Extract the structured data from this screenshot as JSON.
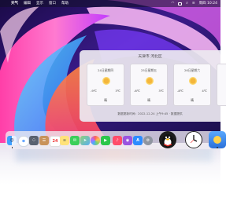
{
  "menubar": {
    "apple_glyph": "",
    "items": [
      "天气",
      "编辑",
      "显示",
      "窗口",
      "帮助"
    ],
    "clock": "周四 10:24"
  },
  "weather": {
    "title": "天津市 河北区",
    "days": [
      {
        "date": "24日星期四",
        "low": "-9℃",
        "high": "3℃",
        "condition": "晴"
      },
      {
        "date": "25日星期五",
        "low": "-6℃",
        "high": "3℃",
        "condition": "晴"
      },
      {
        "date": "26日星期六",
        "low": "-8℃",
        "high": "4℃",
        "condition": "晴"
      }
    ],
    "footer": "数据更新时间：2022-12-24 上午9:45 · 数据提供"
  },
  "dock": {
    "apps": [
      "finder",
      "safari",
      "launchpad",
      "contacts",
      "calendar",
      "notes",
      "messages",
      "maps",
      "photos",
      "facetime",
      "music",
      "podcasts",
      "app-store",
      "system-preferences",
      "qq",
      "clock",
      "weather"
    ]
  },
  "colors": {
    "accent_sun": "#f4b63c",
    "menubar_bg": "#1a1530",
    "panel_bg": "#ece8f0"
  }
}
